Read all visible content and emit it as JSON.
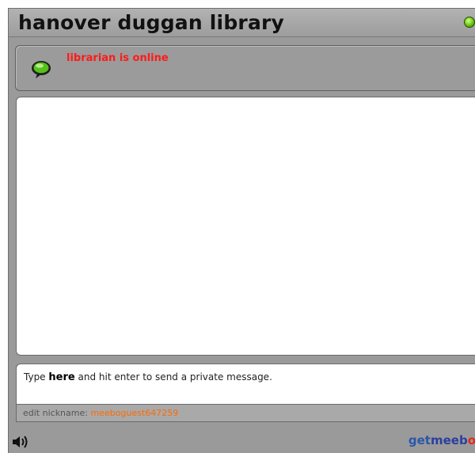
{
  "header": {
    "title": "hanover duggan library",
    "status_icon": "green-status-dot"
  },
  "status": {
    "icon": "chat-bubble-icon",
    "text": "librarian is online"
  },
  "composer": {
    "prefix": "Type ",
    "emphasis": "here",
    "suffix": " and hit enter to send a private message."
  },
  "nickname": {
    "label": "edit nickname: ",
    "value": "meeboguest647259"
  },
  "footer": {
    "sound_icon": "speaker-icon",
    "brand_get": "get",
    "brand_meebo": "meeb",
    "brand_swirl": "o"
  },
  "colors": {
    "online_status": "#ff1a1a",
    "nickname": "#ff6a00",
    "brand_blue": "#2a3fa0",
    "brand_red": "#e8261c",
    "panel_gray": "#9a9a9a"
  }
}
